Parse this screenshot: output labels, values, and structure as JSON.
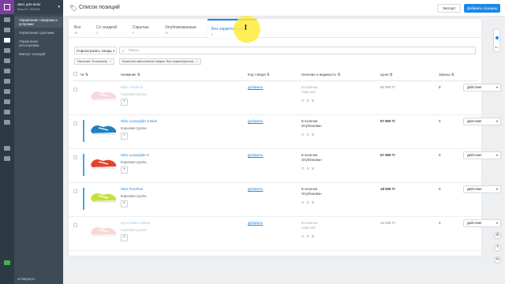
{
  "account": {
    "name": "xБег для всех",
    "id": "Ваш ID: 381551"
  },
  "menu": {
    "items": [
      {
        "label": "Управление товарами и услугами",
        "active": true
      },
      {
        "label": "Управление группами",
        "active": false
      },
      {
        "label": "Управление категориями",
        "active": false
      },
      {
        "label": "Импорт позиций",
        "active": false
      }
    ],
    "collapse_label": "Свернуть"
  },
  "header": {
    "title": "Список позиций",
    "export_label": "Экспорт",
    "add_label": "Добавить позицию"
  },
  "tabs": [
    {
      "label": "Все",
      "count": "15"
    },
    {
      "label": "Со скидкой",
      "count": "0"
    },
    {
      "label": "Скрытые",
      "count": "5"
    },
    {
      "label": "Опубликованные",
      "count": "10"
    },
    {
      "label": "Без характеристик",
      "count": "5"
    }
  ],
  "filter_button": "Отфильтровать товары",
  "search": {
    "placeholder": "Поиск..."
  },
  "chips": [
    {
      "label": "Наличие: В наличии"
    },
    {
      "label": "Качество заполнения товара: Без характеристик"
    }
  ],
  "columns": {
    "num": "№",
    "name": "Название",
    "code": "Код товара",
    "availability": "Наличие и видимость",
    "price": "Цена",
    "orders": "Заказы"
  },
  "rows": [
    {
      "name": "Nike FreeRun",
      "group": "Корневая группа",
      "code": "Добавить",
      "availability": "В наличии",
      "visibility": "Скрытый",
      "price": "65 000 Тг",
      "orders": "0",
      "action": "Действия",
      "muted": true,
      "shoe_color": "#f4a7b4"
    },
    {
      "name": "Nike Lunarglide 6 Blue",
      "group": "Корневая группа",
      "code": "Добавить",
      "availability": "В наличии",
      "visibility": "Опубликован",
      "price": "57 600 Тг",
      "orders": "0",
      "action": "Действия",
      "muted": false,
      "shoe_color": "#1f7fc0"
    },
    {
      "name": "Nike Lunarglide 6",
      "group": "Корневая группа",
      "code": "Добавить",
      "availability": "В наличии",
      "visibility": "Опубликован",
      "price": "57 500 Тг",
      "orders": "0",
      "action": "Действия",
      "muted": false,
      "shoe_color": "#e0442c"
    },
    {
      "name": "Nike FreeRun",
      "group": "Корневая группа",
      "code": "Добавить",
      "availability": "В наличии",
      "visibility": "Опубликован",
      "price": "18 000 Тг",
      "orders": "0",
      "action": "Действия",
      "muted": false,
      "shoe_color": "#c6e03a"
    },
    {
      "name": "Кроссовки Adidas",
      "group": "Корневая группа",
      "code": "Добавить",
      "availability": "В наличии",
      "visibility": "Скрытый",
      "price": "24 000 Тг",
      "orders": "1",
      "action": "Действия",
      "muted": true,
      "shoe_color": "#f2a9a0"
    }
  ],
  "colors": {
    "accent": "#1e88e5",
    "rail": "#2c3a45",
    "panel": "#3d4b56",
    "brand": "#7b3fa0"
  },
  "zoom": "0%"
}
